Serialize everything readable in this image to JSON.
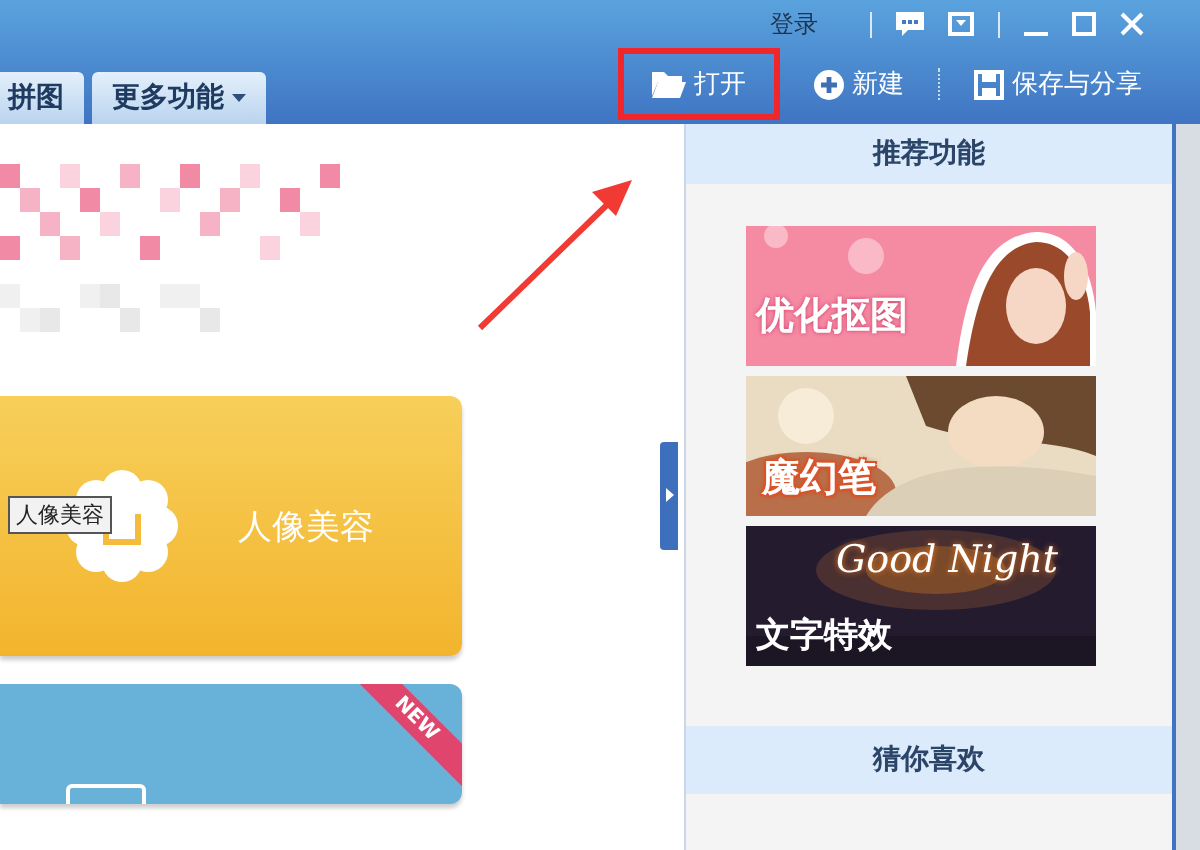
{
  "window": {
    "login": "登录"
  },
  "tabs": [
    {
      "label": "拼图",
      "selected": false,
      "kind": "plain"
    },
    {
      "label": "更多功能",
      "selected": false,
      "kind": "menu"
    }
  ],
  "toolbar": [
    {
      "label": "打开",
      "kind": "open",
      "highlighted": true
    },
    {
      "label": "新建",
      "kind": "new",
      "highlighted": false
    },
    {
      "label": "保存与分享",
      "kind": "save",
      "highlighted": false
    }
  ],
  "main": {
    "cards": [
      {
        "kind": "portrait",
        "label": "人像美容",
        "tooltip": "人像美容"
      },
      {
        "kind": "new",
        "badge": "NEW"
      }
    ]
  },
  "right_panel": {
    "header": "推荐功能",
    "banners": [
      {
        "kind": "pink",
        "label": "优化抠图"
      },
      {
        "kind": "soft",
        "label": "魔幻笔"
      },
      {
        "kind": "night",
        "label": "文字特效",
        "overlay": "Good Night"
      }
    ],
    "section_header": "猜你喜欢"
  }
}
